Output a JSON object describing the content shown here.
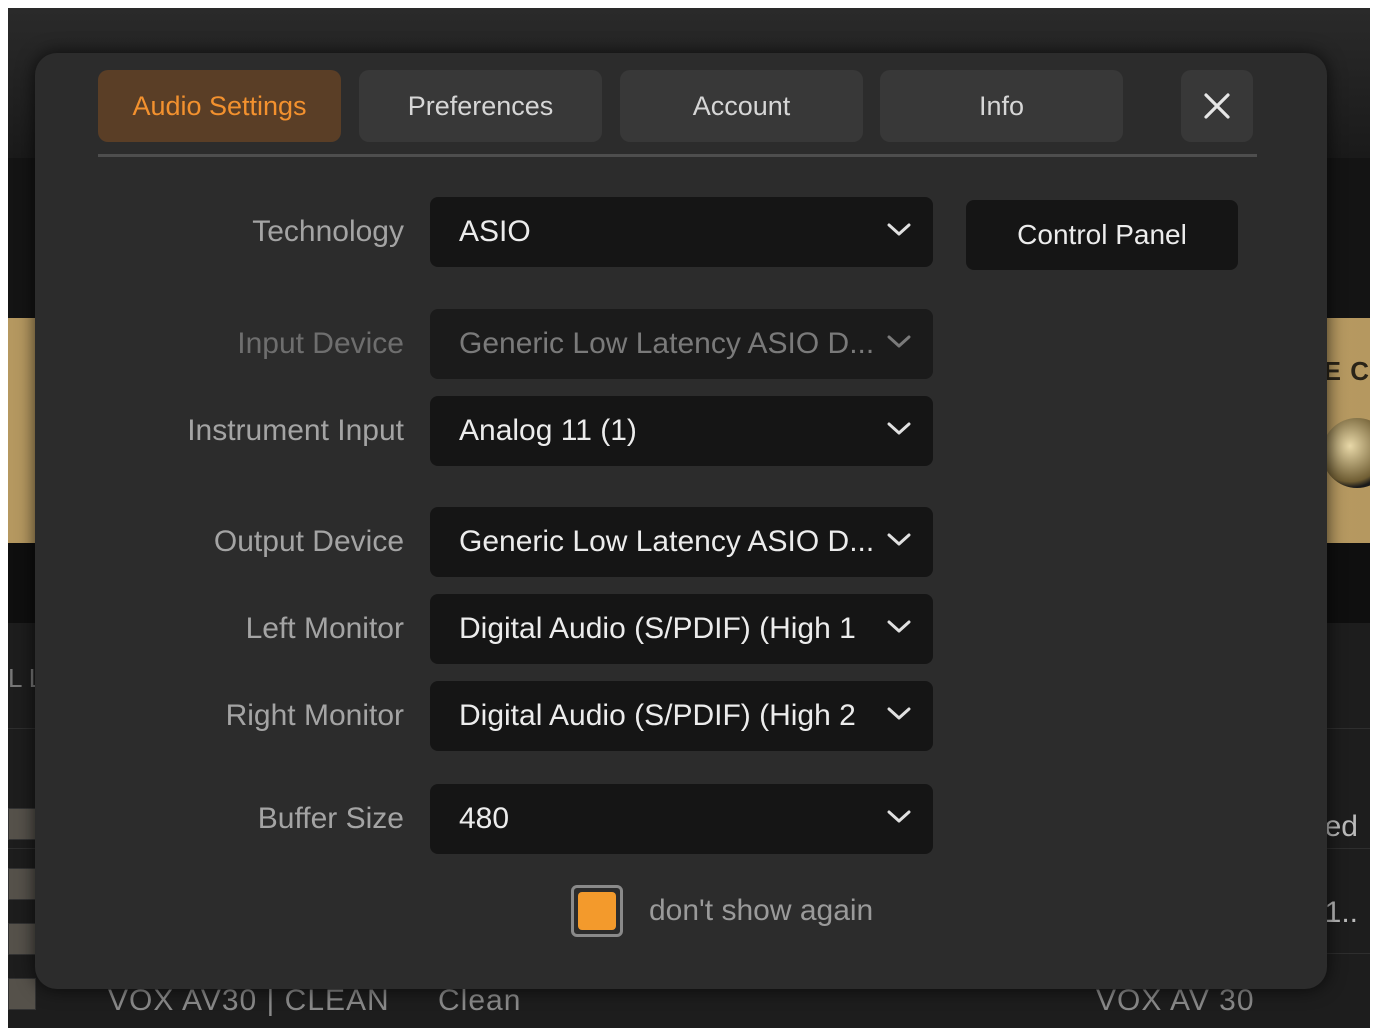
{
  "tabs": [
    {
      "label": "Audio Settings",
      "active": true
    },
    {
      "label": "Preferences",
      "active": false
    },
    {
      "label": "Account",
      "active": false
    },
    {
      "label": "Info",
      "active": false
    }
  ],
  "close_icon": "close-icon",
  "fields": {
    "technology": {
      "label": "Technology",
      "value": "ASIO"
    },
    "input_device": {
      "label": "Input Device",
      "value": "Generic Low Latency ASIO D...",
      "disabled": true
    },
    "instrument_input": {
      "label": "Instrument Input",
      "value": "Analog 11 (1)"
    },
    "output_device": {
      "label": "Output Device",
      "value": "Generic Low Latency ASIO D..."
    },
    "left_monitor": {
      "label": "Left Monitor",
      "value": "Digital Audio (S/PDIF) (High 1"
    },
    "right_monitor": {
      "label": "Right Monitor",
      "value": "Digital Audio (S/PDIF) (High 2"
    },
    "buffer_size": {
      "label": "Buffer Size",
      "value": "480"
    }
  },
  "control_panel_label": "Control Panel",
  "dont_show_again": {
    "label": "don't show again",
    "checked": true
  },
  "colors": {
    "accent": "#f3912e",
    "active_tab_bg": "#5a3e26",
    "modal_bg": "#2c2c2c",
    "field_bg": "#151515",
    "checkbox": "#f39a2c"
  },
  "background": {
    "amp_partial_text": "SE C",
    "left_partial_text": "L L",
    "right_row_1": "ed",
    "right_row_2": "1..",
    "bottom_preset": "VOX AV30 | CLEAN",
    "bottom_category": "Clean",
    "bottom_amp": "VOX AV 30"
  }
}
